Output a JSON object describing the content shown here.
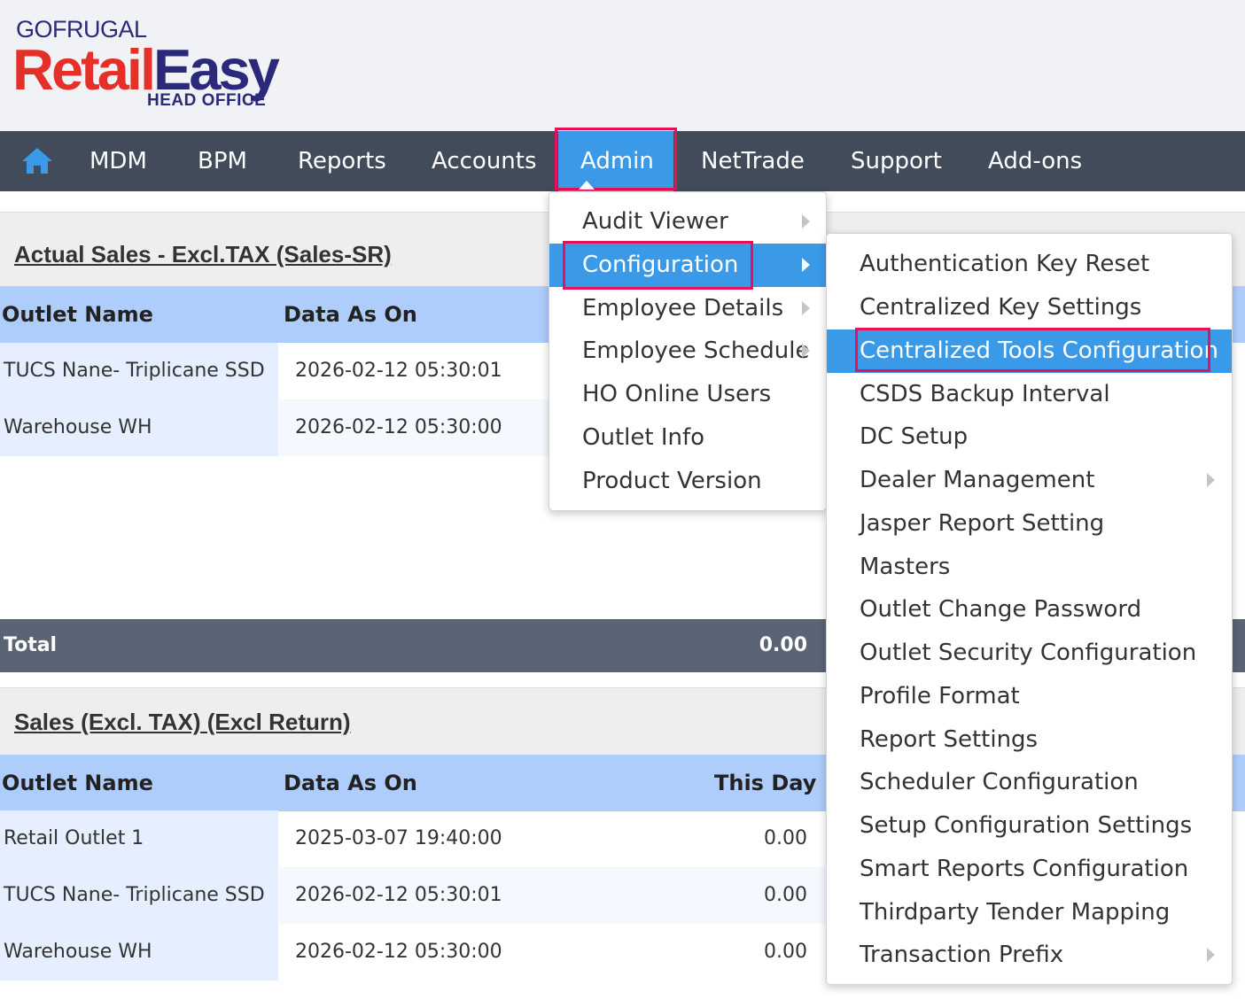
{
  "header": {
    "brand": "GOFRUGAL",
    "product_part1": "Retail",
    "product_part2": "Easy",
    "subtitle": "HEAD OFFICE"
  },
  "nav": {
    "home_icon": "home-icon",
    "items": [
      "MDM",
      "BPM",
      "Reports",
      "Accounts",
      "Admin",
      "NetTrade",
      "Support",
      "Add-ons"
    ],
    "active": "Admin"
  },
  "admin_menu": {
    "items": [
      "Audit Viewer",
      "Configuration",
      "Employee Details",
      "Employee Schedule",
      "HO Online Users",
      "Outlet Info",
      "Product Version"
    ],
    "active": "Configuration"
  },
  "configuration_menu": {
    "items": [
      "Authentication Key Reset",
      "Centralized Key Settings",
      "Centralized Tools Configuration",
      "CSDS Backup Interval",
      "DC Setup",
      "Dealer Management",
      "Jasper Report Setting",
      "Masters",
      "Outlet Change Password",
      "Outlet Security Configuration",
      "Profile Format",
      "Report Settings",
      "Scheduler Configuration",
      "Setup Configuration Settings",
      "Smart Reports Configuration",
      "Thirdparty Tender Mapping",
      "Transaction Prefix"
    ],
    "active": "Centralized Tools Configuration"
  },
  "section1": {
    "title": "Actual Sales - Excl.TAX (Sales-SR)",
    "columns": [
      "Outlet Name",
      "Data As On"
    ],
    "rows": [
      {
        "outlet": "TUCS Nane- Triplicane SSD",
        "date": "2026-02-12 05:30:01"
      },
      {
        "outlet": "Warehouse WH",
        "date": "2026-02-12 05:30:00"
      }
    ],
    "total_label": "Total",
    "total_value": "0.00"
  },
  "section2": {
    "title": "Sales (Excl. TAX) (Excl Return)",
    "columns": [
      "Outlet Name",
      "Data As On",
      "This Day"
    ],
    "rows": [
      {
        "outlet": "Retail Outlet 1",
        "date": "2025-03-07 19:40:00",
        "value": "0.00"
      },
      {
        "outlet": "TUCS Nane- Triplicane SSD",
        "date": "2026-02-12 05:30:01",
        "value": "0.00"
      },
      {
        "outlet": "Warehouse WH",
        "date": "2026-02-12 05:30:00",
        "value": "0.00"
      }
    ]
  },
  "colors": {
    "nav_bg": "#414b5a",
    "accent": "#3b9ae8",
    "highlight": "#e8105a",
    "table_header": "#afcdfb",
    "brand_red": "#e5302a",
    "brand_navy": "#2b2a7a"
  }
}
